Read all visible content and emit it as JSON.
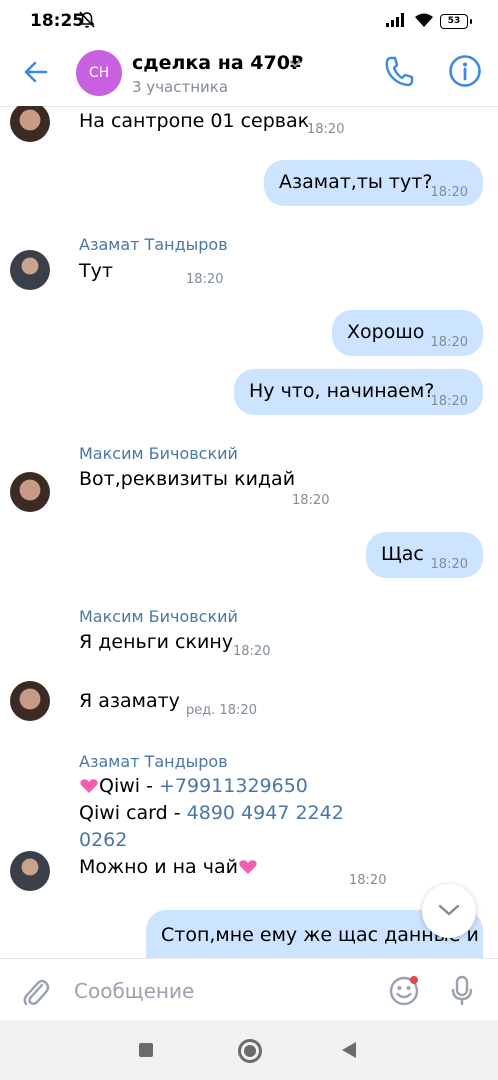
{
  "status": {
    "time": "18:25",
    "battery": "53"
  },
  "header": {
    "avatar_initials": "СН",
    "title": "сделка на 470₽",
    "subtitle": "3 участника"
  },
  "messages": {
    "m1": {
      "text": "На сантропе 01 сервак",
      "time": "18:20"
    },
    "m2": {
      "text": "Азамат,ты тут?",
      "time": "18:20"
    },
    "m3": {
      "sender": "Азамат Тандыров",
      "text": "Тут",
      "time": "18:20"
    },
    "m4": {
      "text": "Хорошо",
      "time": "18:20"
    },
    "m5": {
      "text": "Ну что, начинаем?",
      "time": "18:20"
    },
    "m6": {
      "sender": "Максим Бичовский",
      "text": "Вот,реквизиты кидай",
      "time": "18:20"
    },
    "m7": {
      "text": "Щас",
      "time": "18:20"
    },
    "m8": {
      "sender": "Максим Бичовский",
      "text": "Я деньги скину",
      "time": "18:20"
    },
    "m9": {
      "text": "Я азамату",
      "time": "ред. 18:20"
    },
    "m10": {
      "sender": "Азамат Тандыров",
      "qiwi_label": "Qiwi - ",
      "qiwi_number": "+79911329650",
      "card_label": "Qiwi card - ",
      "card_number_1": "4890 4947 2242",
      "card_number_2": "0262",
      "tea_text": "Можно и на чай",
      "time": "18:20"
    },
    "m11": {
      "text": "Стоп,мне ему же щас данные и"
    }
  },
  "input": {
    "placeholder": "Сообщение"
  },
  "colors": {
    "accent": "#4a76a8",
    "outgoing_bubble": "#cce4ff",
    "chat_avatar": "#c860e0",
    "icon_blue": "#3f8ae0"
  },
  "icons": [
    "mute-icon",
    "signal-icon",
    "wifi-icon",
    "back-icon",
    "chevron-down-icon",
    "phone-icon",
    "info-icon",
    "paperclip-icon",
    "emoji-icon",
    "mic-icon",
    "heart-icon"
  ]
}
